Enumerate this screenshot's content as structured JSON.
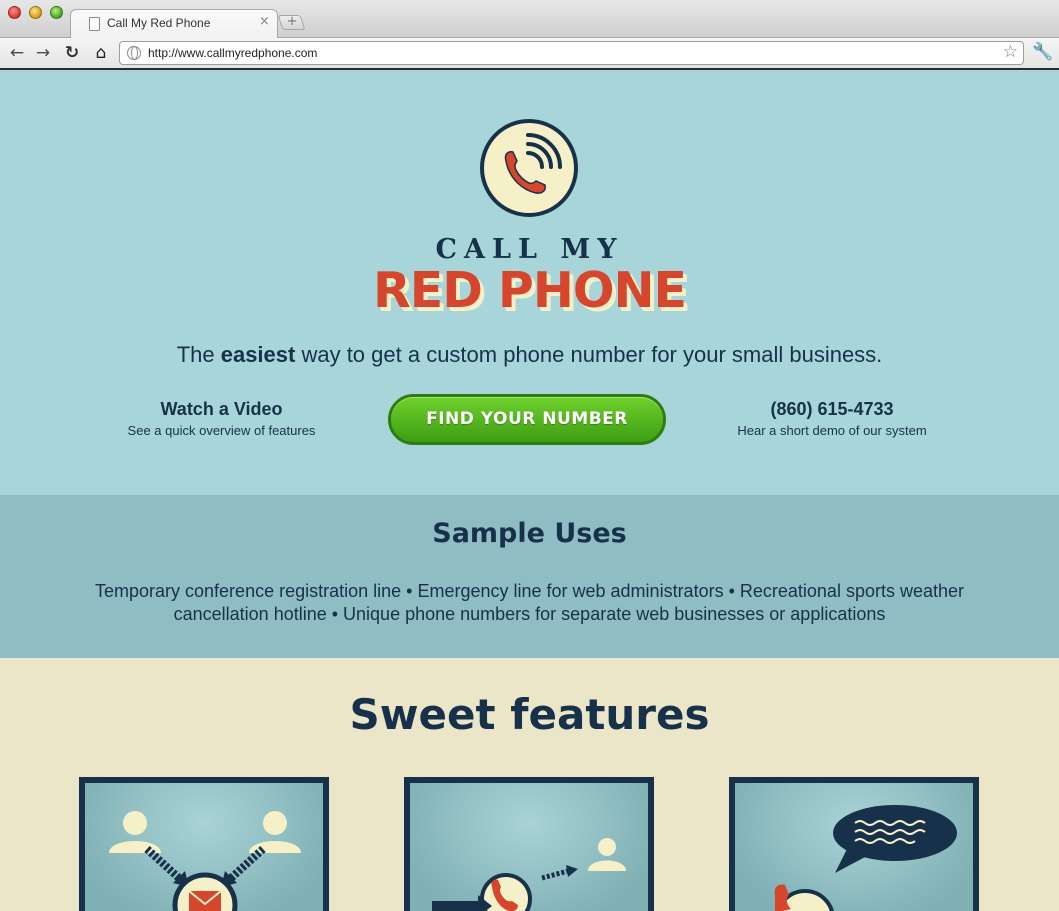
{
  "browser": {
    "tab_title": "Call My Red Phone",
    "tab_close": "×",
    "new_tab": "+",
    "url": "http://www.callmyredphone.com",
    "icons": {
      "back": "back-arrow-icon",
      "forward": "forward-arrow-icon",
      "reload": "reload-icon",
      "home": "home-icon",
      "site": "globe-icon",
      "bookmark": "star-icon",
      "settings": "wrench-icon"
    }
  },
  "hero": {
    "brand_top": "CALL MY",
    "brand_main": "RED PHONE",
    "tagline_pre": "The ",
    "tagline_bold": "easiest",
    "tagline_post": " way to get a custom phone number for your small business.",
    "video_title": "Watch a Video",
    "video_sub": "See a quick overview of features",
    "cta_button": "FIND YOUR NUMBER",
    "phone_number": "(860) 615-4733",
    "phone_sub": "Hear a short demo of our system"
  },
  "uses": {
    "title": "Sample Uses",
    "text": "Temporary conference registration line • Emergency line for web administrators • Recreational sports weather cancellation hotline • Unique phone numbers for separate web businesses or applications"
  },
  "features": {
    "title": "Sweet features",
    "cards": [
      {
        "icon": "people-converging-icon"
      },
      {
        "icon": "phone-forward-icon"
      },
      {
        "icon": "voicemail-speech-icon"
      }
    ]
  },
  "colors": {
    "navy": "#17314b",
    "red": "#d5462c",
    "cream": "#f6f0c9",
    "hero_bg": "#a8d5d9",
    "uses_bg": "#8fbdc3",
    "features_bg": "#ebe6c8",
    "button_green": "#4fb41b"
  }
}
